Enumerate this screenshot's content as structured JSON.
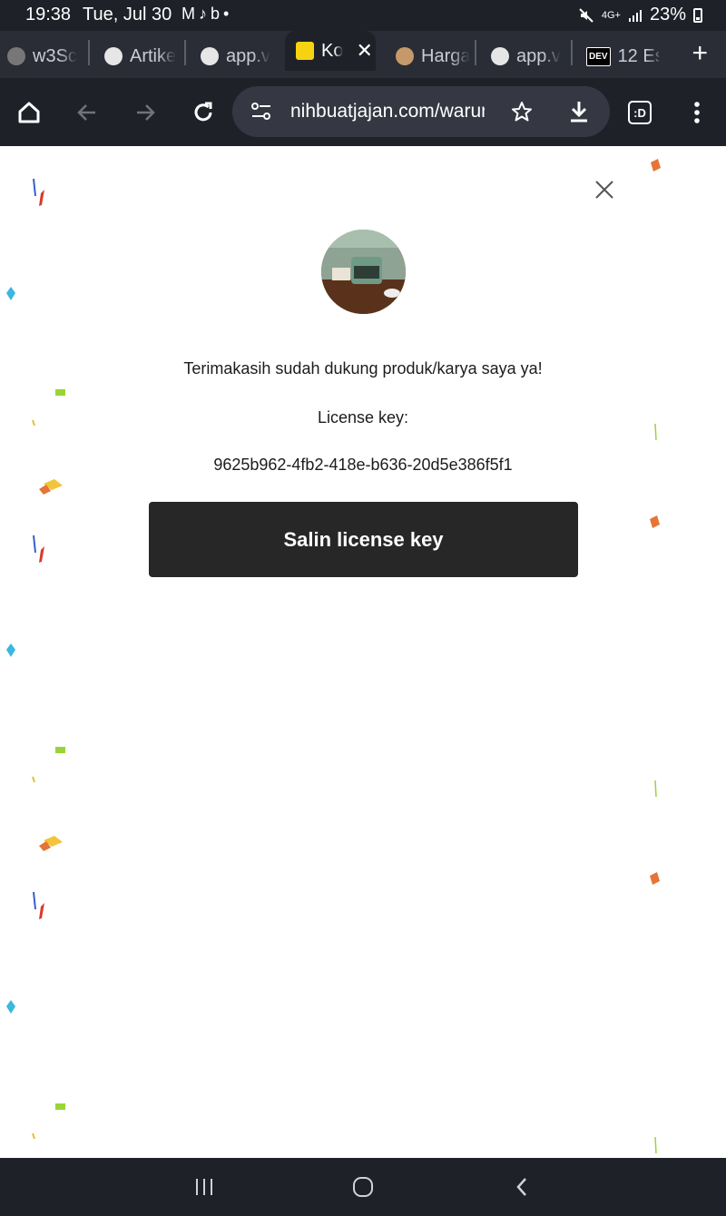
{
  "status_bar": {
    "time": "19:38",
    "date": "Tue, Jul 30",
    "notification_icons": [
      "gmail-icon",
      "tiktok-icon",
      "bing-icon",
      "dot-icon"
    ],
    "network": "4G+",
    "battery": "23%"
  },
  "tabs": [
    {
      "label": "w3Sc",
      "icon": "w3schools-icon"
    },
    {
      "label": "Artike",
      "icon": "site-icon"
    },
    {
      "label": "app.v",
      "icon": "site-icon"
    },
    {
      "label": "Ko",
      "icon": "kofi-icon",
      "active": true
    },
    {
      "label": "Harga",
      "icon": "coffee-icon"
    },
    {
      "label": "app.v",
      "icon": "site-icon"
    },
    {
      "label": "12 Es",
      "icon": "dev-icon",
      "badge": "DEV"
    }
  ],
  "toolbar": {
    "url": "nihbuatjajan.com/warung",
    "tab_counter": ":D"
  },
  "dialog": {
    "thanks_text": "Terimakasih sudah dukung produk/karya saya ya!",
    "license_label": "License key:",
    "license_value": "9625b962-4fb2-418e-b636-20d5e386f5f1",
    "copy_button": "Salin license key"
  },
  "colors": {
    "chrome_bg": "#1f2128",
    "button_bg": "#272727",
    "page_bg": "#ffffff"
  }
}
